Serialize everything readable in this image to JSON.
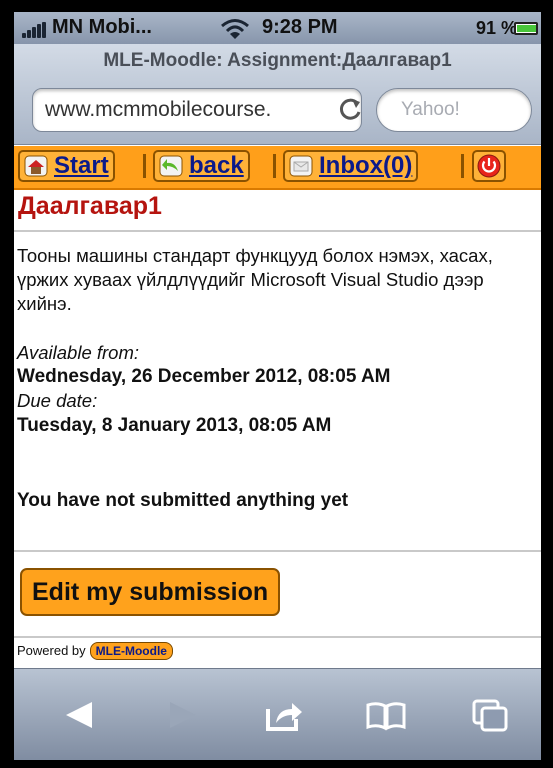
{
  "status_bar": {
    "carrier": "MN Mobi...",
    "time": "9:28 PM",
    "battery": "91 %"
  },
  "browser": {
    "page_title": "MLE-Moodle: Assignment:Даалгавар1",
    "url": "www.mcmmobilecourse.",
    "search_placeholder": "Yahoo!"
  },
  "nav": {
    "start": "Start",
    "back": "back",
    "inbox": "Inbox(0)"
  },
  "assignment": {
    "title": "Даалгавар1",
    "description": "Тооны машины стандарт функцууд болох нэмэх, хасах, үржих хуваах үйлдлүүдийг Microsoft Visual Studio дээр хийнэ.",
    "available_label": "Available from:",
    "available_value": "Wednesday, 26 December 2012, 08:05 AM",
    "due_label": "Due date:",
    "due_value": "Tuesday, 8 January 2013, 08:05 AM",
    "submission_status": "You have not submitted anything yet",
    "edit_button": "Edit my submission"
  },
  "footer": {
    "powered_by": "Powered by",
    "badge": "MLE-Moodle"
  },
  "colors": {
    "accent_orange": "#ff9f1a",
    "heading_red": "#b5140f",
    "link_blue": "#0b1a8a"
  },
  "icons": [
    "signal-icon",
    "wifi-icon",
    "battery-icon",
    "reload-icon",
    "home-icon",
    "back-arrow-icon",
    "mail-icon",
    "power-icon",
    "back-icon",
    "forward-icon",
    "share-icon",
    "bookmarks-icon",
    "tabs-icon"
  ]
}
